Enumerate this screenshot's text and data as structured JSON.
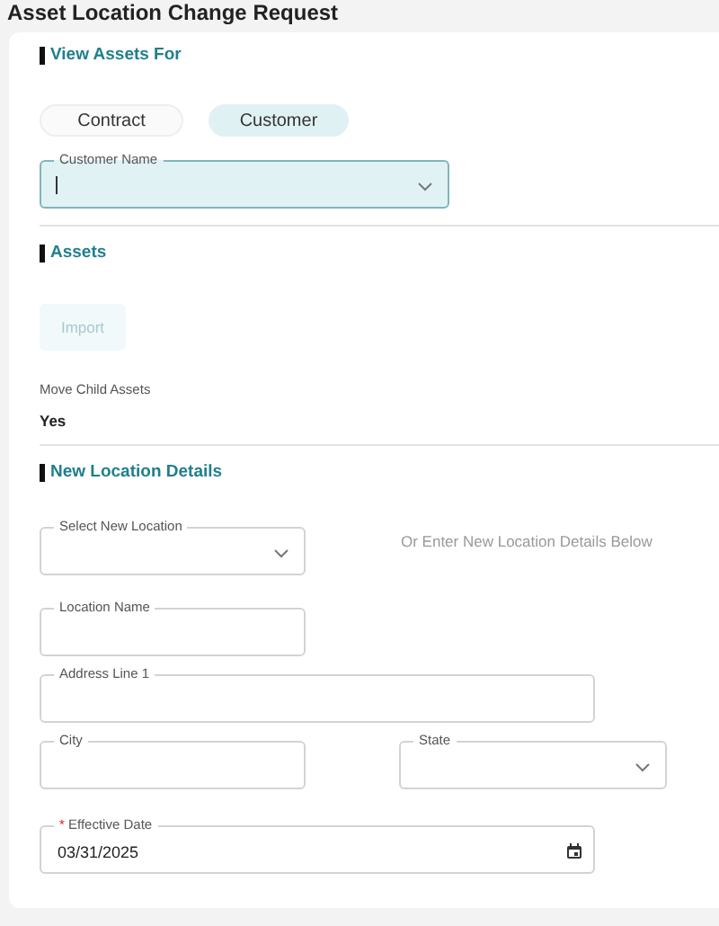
{
  "title": "Asset Location Change Request",
  "view_assets_for": {
    "heading": "View Assets For",
    "options": [
      {
        "label": "Contract",
        "selected": false
      },
      {
        "label": "Customer",
        "selected": true
      }
    ],
    "customer_field": {
      "label": "Customer Name",
      "kind": "select",
      "focused": true
    }
  },
  "assets": {
    "heading": "Assets",
    "import_button": {
      "label": "Import",
      "disabled": true
    },
    "move_child_assets": {
      "label": "Move Child Assets",
      "value": "Yes"
    }
  },
  "new_location": {
    "heading": "New Location Details",
    "select_location": {
      "label": "Select New Location",
      "kind": "select"
    },
    "hint": "Or Enter New Location Details Below",
    "fields": [
      {
        "label": "Location Name",
        "kind": "text"
      },
      {
        "label": "Address Line 1",
        "kind": "text"
      },
      {
        "label": "City",
        "kind": "text"
      },
      {
        "label": "State",
        "kind": "select"
      },
      {
        "label": "Effective Date",
        "kind": "date",
        "required_mark": "*",
        "value": "03/31/2025"
      }
    ]
  }
}
